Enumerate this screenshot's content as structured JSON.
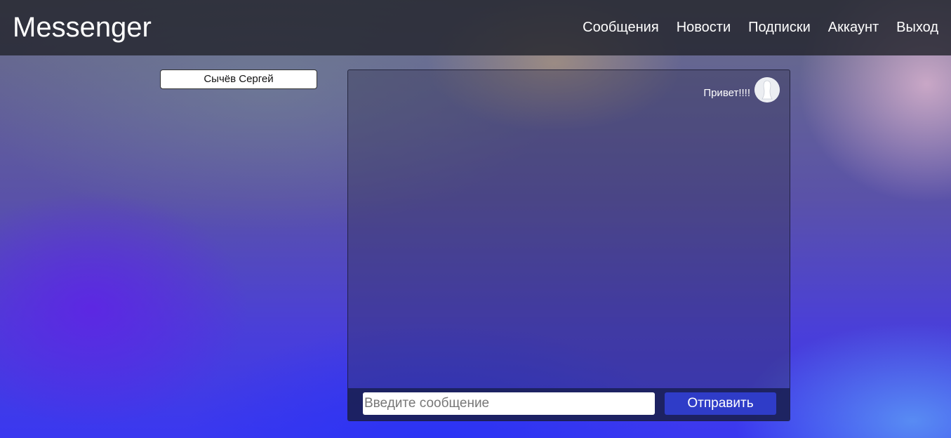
{
  "header": {
    "brand": "Messenger",
    "nav": [
      {
        "label": "Сообщения"
      },
      {
        "label": "Новости"
      },
      {
        "label": "Подписки"
      },
      {
        "label": "Аккаунт"
      },
      {
        "label": "Выход"
      }
    ]
  },
  "contacts": [
    {
      "name": "Сычёв Сергей"
    }
  ],
  "chat": {
    "messages": [
      {
        "text": "Привет!!!!",
        "avatar_icon": "user-silhouette-icon"
      }
    ],
    "composer": {
      "input_value": "",
      "placeholder": "Введите сообщение",
      "send_label": "Отправить"
    }
  },
  "colors": {
    "header_bg": "#23252d",
    "send_button": "#2f3cc8",
    "composer_bg": "#191e55"
  }
}
